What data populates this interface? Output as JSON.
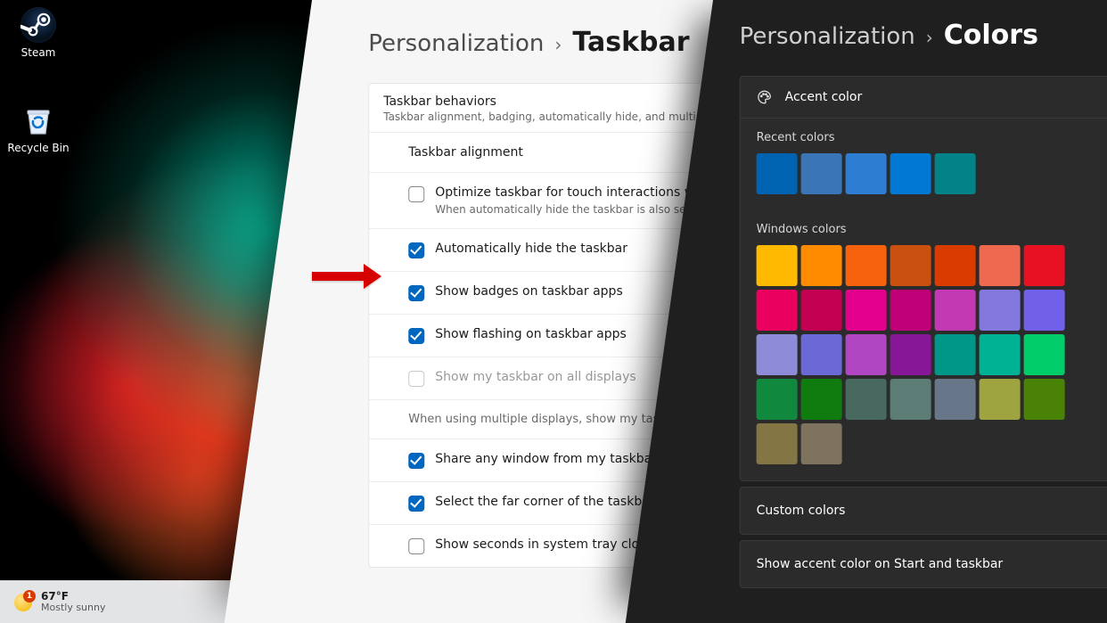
{
  "desktop": {
    "icons": {
      "steam": {
        "label": "Steam"
      },
      "recycle": {
        "label": "Recycle Bin"
      }
    },
    "taskbar": {
      "weather": {
        "temp": "67°F",
        "cond": "Mostly sunny",
        "badge": "1"
      }
    }
  },
  "panel_taskbar": {
    "breadcrumb": {
      "parent": "Personalization",
      "current": "Taskbar"
    },
    "header": {
      "title": "Taskbar behaviors",
      "subtitle": "Taskbar alignment, badging, automatically hide, and multiple displays"
    },
    "rows": {
      "alignment": {
        "label": "Taskbar alignment"
      },
      "touch": {
        "label": "Optimize taskbar for touch interactions when this",
        "checked": false,
        "hint": "When automatically hide the taskbar is also selected, touch-o"
      },
      "autohide": {
        "label": "Automatically hide the taskbar",
        "checked": true
      },
      "badges": {
        "label": "Show badges on taskbar apps",
        "checked": true
      },
      "flashing": {
        "label": "Show flashing on taskbar apps",
        "checked": true
      },
      "alldisplays": {
        "label": "Show my taskbar on all displays",
        "checked": false
      },
      "multidesc": {
        "label": "When using multiple displays, show my taskbar ap"
      },
      "shareany": {
        "label": "Share any window from my taskbar",
        "checked": true
      },
      "farcorner": {
        "label": "Select the far corner of the taskbar to show t",
        "checked": true
      },
      "seconds": {
        "label": "Show seconds in system tray clock (uses mo",
        "checked": false
      }
    }
  },
  "panel_colors": {
    "breadcrumb": {
      "parent": "Personalization",
      "current": "Colors"
    },
    "accent_label": "Accent color",
    "recent_label": "Recent colors",
    "recent": [
      "#0063b1",
      "#3a76b7",
      "#2d7dd2",
      "#0078d4",
      "#038387"
    ],
    "windows_label": "Windows colors",
    "windows": [
      "#ffb900",
      "#ff8c00",
      "#f7630c",
      "#ca5010",
      "#da3b01",
      "#ef6950",
      "#e81123",
      "#ea005e",
      "#c30052",
      "#e3008c",
      "#bf0077",
      "#c239b3",
      "#8378de",
      "#7160e8",
      "#8e8cd8",
      "#6b69d6",
      "#b146c2",
      "#881798",
      "#009688",
      "#00b294",
      "#00cc6a",
      "#10893e",
      "#107c10",
      "#486860",
      "#5b7d76",
      "#68768a",
      "#9ea440",
      "#498205",
      "#847545",
      "#7e735f"
    ],
    "custom_label": "Custom colors",
    "accent_on_start_label": "Show accent color on Start and taskbar"
  }
}
